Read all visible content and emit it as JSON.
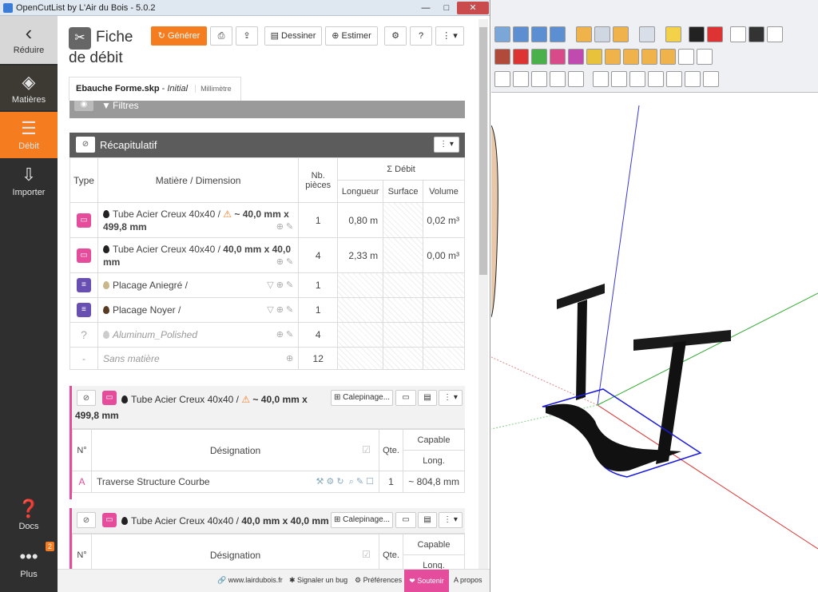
{
  "window": {
    "title": "OpenCutList by L'Air du Bois - 5.0.2",
    "minimize": "—",
    "maximize": "□",
    "close": "✕"
  },
  "sidebar": {
    "reduce": "Réduire",
    "materials": "Matières",
    "debit": "Débit",
    "import": "Importer",
    "docs": "Docs",
    "plus": "Plus",
    "plus_badge": "2"
  },
  "header": {
    "title": "Fiche de débit",
    "generate": "Générer",
    "draw": "Dessiner",
    "estimate": "Estimer"
  },
  "filetab": {
    "filename": "Ebauche Forme.skp",
    "state": "Initial",
    "unit": "Millimètre"
  },
  "filters": {
    "label": "Filtres"
  },
  "summary": {
    "title": "Récapitulatif",
    "headers": {
      "type": "Type",
      "material": "Matière / Dimension",
      "count": "Nb. pièces",
      "sum": "Σ Débit",
      "length": "Longueur",
      "surface": "Surface",
      "volume": "Volume"
    },
    "rows": [
      {
        "name": "Tube Acier Creux 40x40 /",
        "dim": "~ 40,0 mm x 499,8 mm",
        "count": "1",
        "length": "0,80 m",
        "volume": "0,02 m³"
      },
      {
        "name": "Tube Acier Creux 40x40 /",
        "dim": "40,0 mm x 40,0 mm",
        "count": "4",
        "length": "2,33 m",
        "volume": "0,00 m³"
      },
      {
        "name": "Placage Aniegré /",
        "dim": "",
        "count": "1"
      },
      {
        "name": "Placage Noyer /",
        "dim": "",
        "count": "1"
      },
      {
        "name": "Aluminum_Polished",
        "dim": "",
        "count": "4"
      },
      {
        "name": "Sans matière",
        "dim": "",
        "count": "12"
      }
    ]
  },
  "group1": {
    "name": "Tube Acier Creux 40x40 /",
    "dim_a": "~ 40,0 mm x",
    "dim_b": "499,8 mm",
    "calepinage": "Calepinage...",
    "headers": {
      "num": "N°",
      "designation": "Désignation",
      "qty": "Qte.",
      "capable": "Capable",
      "long": "Long."
    },
    "rows": [
      {
        "num": "A",
        "designation": "Traverse Structure Courbe",
        "qty": "1",
        "long": "~ 804,8 mm"
      }
    ]
  },
  "group2": {
    "name": "Tube Acier Creux 40x40 /",
    "dim": "40,0 mm x 40,0 mm",
    "calepinage": "Calepinage...",
    "headers": {
      "num": "N°",
      "designation": "Désignation",
      "qty": "Qte.",
      "capable": "Capable",
      "long": "Long."
    }
  },
  "footer": {
    "site": "www.lairdubois.fr",
    "bug": "Signaler un bug",
    "prefs": "Préférences",
    "support": "Soutenir",
    "about": "A propos"
  }
}
